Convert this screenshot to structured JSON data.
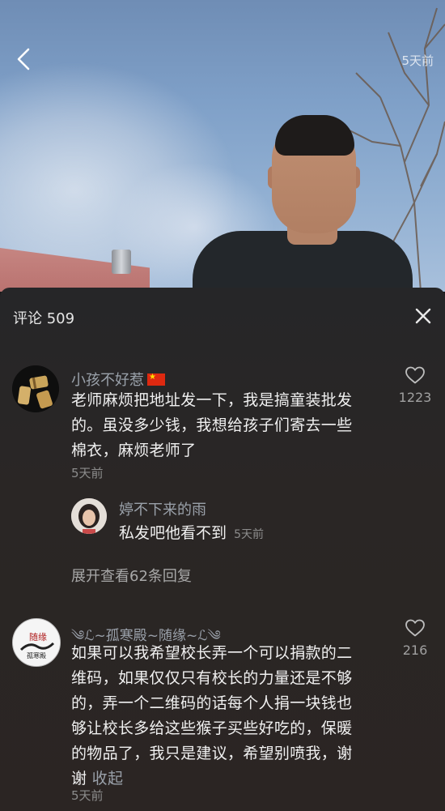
{
  "video": {
    "time": "5天前"
  },
  "comments_panel": {
    "title_label": "评论",
    "count": "509"
  },
  "comments": [
    {
      "username": "小孩不好惹",
      "has_flag": true,
      "text_lines": [
        "老师麻烦把地址发一下，我是搞童装批发",
        "的。虽没多少钱，我想给孩子们寄去一些",
        "棉衣，麻烦老师了"
      ],
      "time": "5天前",
      "likes": "1223",
      "replies": [
        {
          "username": "婷不下来的雨",
          "text": "私发吧他看不到",
          "time": "5天前"
        }
      ],
      "expand_label": "展开查看62条回复"
    },
    {
      "username": "༄ℒ~孤寒殿~随缘~ℒ༄",
      "avatar_text": "随缘",
      "avatar_sub": "孤寒殿",
      "text_lines": [
        "如果可以我希望校长弄一个可以捐款的二",
        "维码，如果仅仅只有校长的力量还是不够",
        "的，弄一个二维码的话每个人捐一块钱也",
        "够让校长多给这些猴子买些好吃的，保暖",
        "的物品了，我只是建议，希望别喷我，谢",
        "谢"
      ],
      "collapse_label": "收起",
      "time": "5天前",
      "likes": "216"
    }
  ],
  "icons": {
    "back": "chevron-left-icon",
    "close": "close-icon",
    "like": "heart-icon"
  },
  "colors": {
    "panel_bg": "#262628",
    "text": "#f0f0f0",
    "username": "#9aa1aa",
    "muted": "#8c8c8c"
  }
}
